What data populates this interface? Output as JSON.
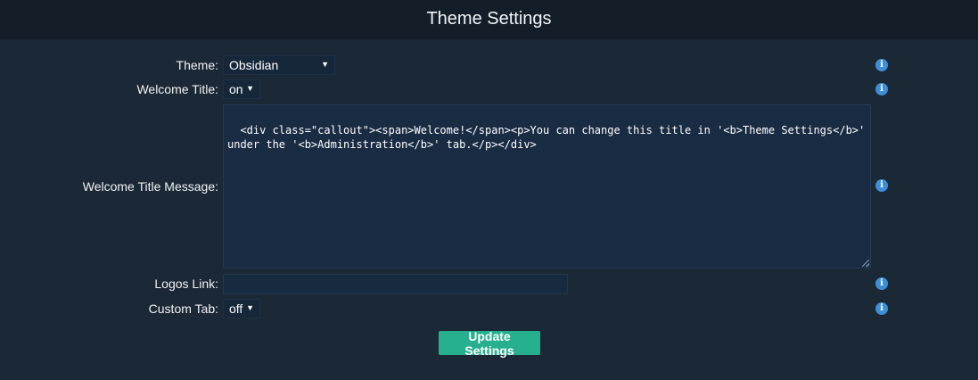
{
  "header": {
    "title": "Theme Settings"
  },
  "form": {
    "theme": {
      "label": "Theme:",
      "value": "Obsidian"
    },
    "welcome_title": {
      "label": "Welcome Title:",
      "value": "on"
    },
    "welcome_message": {
      "label": "Welcome Title Message:",
      "value": "<div class=\"callout\"><span>Welcome!</span><p>You can change this title in '<b>Theme Settings</b>' under the '<b>Administration</b>' tab.</p></div>"
    },
    "logos_link": {
      "label": "Logos Link:",
      "value": ""
    },
    "custom_tab": {
      "label": "Custom Tab:",
      "value": "off"
    }
  },
  "icons": {
    "info": "i",
    "dropdown": "▼"
  },
  "actions": {
    "submit_label": "Update Settings"
  },
  "colors": {
    "accent": "#26b08f",
    "info": "#3f8fd6",
    "background": "#1b2836",
    "header": "#141e29"
  }
}
